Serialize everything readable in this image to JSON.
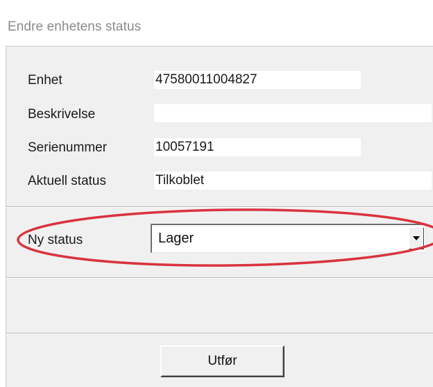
{
  "window": {
    "title": "Endre enhetens status"
  },
  "fields": [
    {
      "label": "Enhet",
      "value": "47580011004827"
    },
    {
      "label": "Beskrivelse",
      "value": ""
    },
    {
      "label": "Serienummer",
      "value": "10057191"
    },
    {
      "label": "Aktuell status",
      "value": "Tilkoblet"
    }
  ],
  "new_status": {
    "label": "Ny status",
    "selected": "Lager",
    "highlight_color": "#d9333f"
  },
  "actions": {
    "run_label": "Utfør"
  },
  "icons": {
    "dropdown": "chevron-down-icon"
  }
}
